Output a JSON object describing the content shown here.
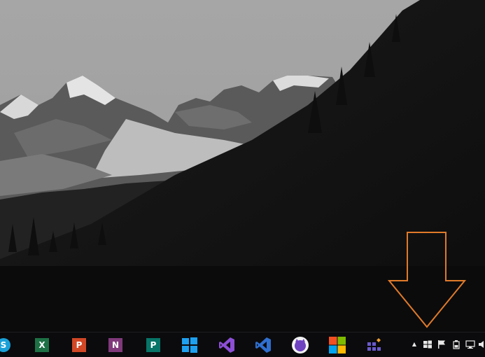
{
  "desktop": {
    "wallpaper": "grayscale-mountain-landscape",
    "annotation_arrow_color": "#e07a2a"
  },
  "taskbar": {
    "background": "#0b0b0d",
    "pinned_apps": [
      {
        "name": "skype-icon",
        "glyph": "S",
        "color": "#1aa0d8"
      },
      {
        "name": "excel-icon",
        "glyph": "X",
        "color": "#1e7145"
      },
      {
        "name": "powerpoint-icon",
        "glyph": "P",
        "color": "#d24726"
      },
      {
        "name": "onenote-icon",
        "glyph": "N",
        "color": "#80397b"
      },
      {
        "name": "publisher-icon",
        "glyph": "P",
        "color": "#077568"
      },
      {
        "name": "windows-store-icon",
        "color": "#1ea0f0"
      },
      {
        "name": "visual-studio-purple-icon",
        "color": "#8c4fd6"
      },
      {
        "name": "visual-studio-blue-icon",
        "color": "#2f6fd0"
      },
      {
        "name": "github-desktop-icon",
        "color": "#6f42c1"
      },
      {
        "name": "microsoft-store-icon"
      },
      {
        "name": "app-tiles-icon",
        "color": "#6a5acd"
      }
    ],
    "system_tray": [
      {
        "name": "show-hidden-icons-chevron-icon",
        "glyph": "▲"
      },
      {
        "name": "windows-tray-icon"
      },
      {
        "name": "action-center-flag-icon"
      },
      {
        "name": "battery-icon"
      },
      {
        "name": "network-icon"
      },
      {
        "name": "volume-icon"
      }
    ]
  }
}
